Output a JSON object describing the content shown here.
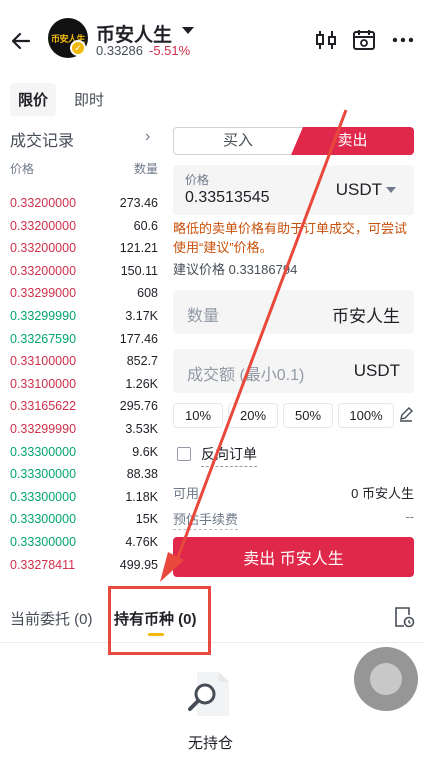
{
  "header": {
    "logo_text": "币安人生",
    "title": "币安人生",
    "last_price": "0.33286",
    "change": "-5.51%"
  },
  "order_type_tabs": [
    "限价",
    "即时"
  ],
  "trades": {
    "title": "成交记录",
    "col_price": "价格",
    "col_qty": "数量",
    "rows": [
      {
        "price": "0.33200000",
        "qty": "273.46",
        "side": "sell"
      },
      {
        "price": "0.33200000",
        "qty": "60.6",
        "side": "sell"
      },
      {
        "price": "0.33200000",
        "qty": "121.21",
        "side": "sell"
      },
      {
        "price": "0.33200000",
        "qty": "150.11",
        "side": "sell"
      },
      {
        "price": "0.33299000",
        "qty": "608",
        "side": "sell"
      },
      {
        "price": "0.33299990",
        "qty": "3.17K",
        "side": "buy"
      },
      {
        "price": "0.33267590",
        "qty": "177.46",
        "side": "buy"
      },
      {
        "price": "0.33100000",
        "qty": "852.7",
        "side": "sell"
      },
      {
        "price": "0.33100000",
        "qty": "1.26K",
        "side": "sell"
      },
      {
        "price": "0.33165622",
        "qty": "295.76",
        "side": "sell"
      },
      {
        "price": "0.33299990",
        "qty": "3.53K",
        "side": "sell"
      },
      {
        "price": "0.33300000",
        "qty": "9.6K",
        "side": "buy"
      },
      {
        "price": "0.33300000",
        "qty": "88.38",
        "side": "buy"
      },
      {
        "price": "0.33300000",
        "qty": "1.18K",
        "side": "buy"
      },
      {
        "price": "0.33300000",
        "qty": "15K",
        "side": "buy"
      },
      {
        "price": "0.33300000",
        "qty": "4.76K",
        "side": "buy"
      },
      {
        "price": "0.33278411",
        "qty": "499.95",
        "side": "sell"
      }
    ]
  },
  "order_form": {
    "buy_tab": "买入",
    "sell_tab": "卖出",
    "price_label": "价格",
    "price_value": "0.33513545",
    "price_unit": "USDT",
    "warning": "略低的卖单价格有助于订单成交，可尝试使用“建议”价格。",
    "suggested": "建议价格 0.33186794",
    "qty_placeholder": "数量",
    "qty_unit": "币安人生",
    "cost_placeholder": "成交额 (最小0.1)",
    "cost_unit": "USDT",
    "pcts": [
      "10%",
      "20%",
      "50%",
      "100%"
    ],
    "reverse_label": "反向订单",
    "available_label": "可用",
    "available_value": "0 币安人生",
    "fee_label": "预估手续费",
    "fee_value": "--",
    "submit": "卖出 币安人生"
  },
  "bottom_tabs": {
    "open_orders": "当前委托 (0)",
    "holdings": "持有币种 (0)"
  },
  "empty_state": "无持仓",
  "colors": {
    "sell": "#cf304a",
    "buy": "#03a66d",
    "accent": "#e0294a",
    "warning": "#c8510b",
    "highlight": "#f0b90b"
  }
}
